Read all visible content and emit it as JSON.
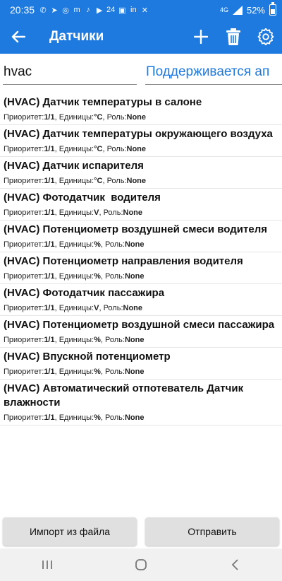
{
  "status_bar": {
    "time": "20:35",
    "notifications": [
      "✆",
      "➤",
      "◎",
      "m",
      "♪",
      "▶",
      "24",
      "▣",
      "in",
      "✕"
    ],
    "network": "4G",
    "battery_text": "52%",
    "battery_level": 0.52
  },
  "app_bar": {
    "title": "Датчики",
    "color": "#1f7ae0"
  },
  "search": {
    "value": "hvac",
    "filter_value": "Поддерживается ап"
  },
  "sensors": [
    {
      "name": "(HVAC) Датчик температуры в салоне",
      "priority_label": "Приоритет:",
      "priority": "1/1",
      "units_label": ", Единицы:",
      "units": "°C",
      "role_label": ", Роль:",
      "role": "None"
    },
    {
      "name": "(HVAC) Датчик температуры окружающего воздуха",
      "priority_label": "Приоритет:",
      "priority": "1/1",
      "units_label": ", Единицы:",
      "units": "°C",
      "role_label": ", Роль:",
      "role": "None"
    },
    {
      "name": "(HVAC) Датчик испарителя",
      "priority_label": "Приоритет:",
      "priority": "1/1",
      "units_label": ", Единицы:",
      "units": "°C",
      "role_label": ", Роль:",
      "role": "None"
    },
    {
      "name": "(HVAC) Фотодатчик  водителя",
      "priority_label": "Приоритет:",
      "priority": "1/1",
      "units_label": ", Единицы:",
      "units": "V",
      "role_label": ", Роль:",
      "role": "None"
    },
    {
      "name": "(HVAC) Потенциометр воздушней смеси водителя",
      "priority_label": "Приоритет:",
      "priority": "1/1",
      "units_label": ", Единицы:",
      "units": "%",
      "role_label": ", Роль:",
      "role": "None"
    },
    {
      "name": "(HVAC) Потенциометр направления водителя",
      "priority_label": "Приоритет:",
      "priority": "1/1",
      "units_label": ", Единицы:",
      "units": "%",
      "role_label": ", Роль:",
      "role": "None"
    },
    {
      "name": "(HVAC) Фотодатчик пассажира",
      "priority_label": "Приоритет:",
      "priority": "1/1",
      "units_label": ", Единицы:",
      "units": "V",
      "role_label": ", Роль:",
      "role": "None"
    },
    {
      "name": "(HVAC) Потенциометр воздушной смеси пассажира",
      "priority_label": "Приоритет:",
      "priority": "1/1",
      "units_label": ", Единицы:",
      "units": "%",
      "role_label": ", Роль:",
      "role": "None"
    },
    {
      "name": "(HVAC) Впускной потенциометр",
      "priority_label": "Приоритет:",
      "priority": "1/1",
      "units_label": ", Единицы:",
      "units": "%",
      "role_label": ", Роль:",
      "role": "None"
    },
    {
      "name": "(HVAC) Автоматический отпотеватель Датчик влажности",
      "priority_label": "Приоритет:",
      "priority": "1/1",
      "units_label": ", Единицы:",
      "units": "%",
      "role_label": ", Роль:",
      "role": "None"
    }
  ],
  "buttons": {
    "import": "Импорт из файла",
    "send": "Отправить"
  },
  "icons": {
    "back": "arrow-left-icon",
    "add": "plus-icon",
    "delete": "trash-icon",
    "settings": "gear-icon"
  }
}
